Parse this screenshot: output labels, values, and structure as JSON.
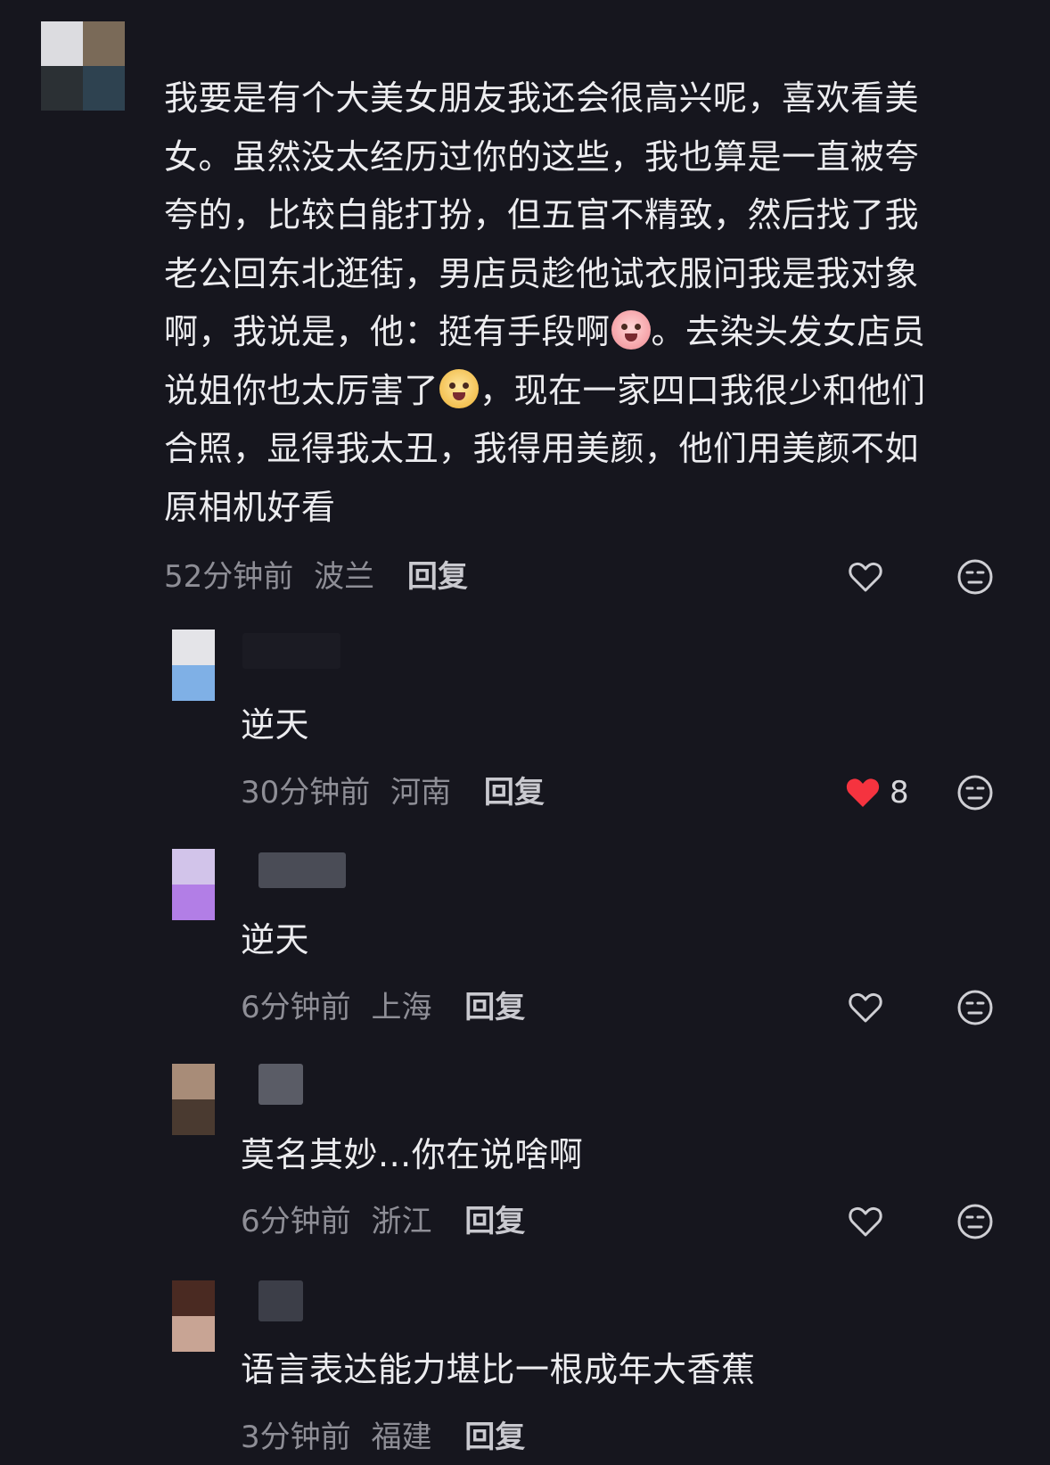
{
  "comments": [
    {
      "text_lines": [
        "我要是有个大美女朋友我还会很高兴呢，喜欢看美",
        "女。虽然没太经历过你的这些，我也算是一直被夸",
        "夸的，比较白能打扮，但五官不精致，然后找了我",
        "老公回东北逛街，男店员趁他试衣服问我是我对象",
        "啊，我说是，他：挺有手段啊",
        "。去染头发女店员",
        "说姐你也太厉害了",
        "，现在一家四口我很少和他们",
        "合照，显得我太丑，我得用美颜，他们用美颜不如",
        "原相机好看"
      ],
      "time": "52分钟前",
      "location": "波兰",
      "reply_label": "回复",
      "liked": false,
      "like_count": "",
      "avatar_colors": [
        "#dcdce0",
        "#7a6a58",
        "#2b3034",
        "#2e4250"
      ]
    },
    {
      "text": "逆天",
      "time": "30分钟前",
      "location": "河南",
      "reply_label": "回复",
      "liked": true,
      "like_count": "8",
      "avatar_colors": [
        "#e4e4e8",
        "#7fb0e6"
      ]
    },
    {
      "text": "逆天",
      "time": "6分钟前",
      "location": "上海",
      "reply_label": "回复",
      "liked": false,
      "like_count": "",
      "avatar_colors": [
        "#d2c4ea",
        "#b27ee6"
      ]
    },
    {
      "text": "莫名其妙...你在说啥啊",
      "time": "6分钟前",
      "location": "浙江",
      "reply_label": "回复",
      "liked": false,
      "like_count": "",
      "avatar_colors": [
        "#a88c78",
        "#4a3a30"
      ]
    },
    {
      "text": "语言表达能力堪比一根成年大香蕉",
      "time": "3分钟前",
      "location": "福建",
      "reply_label": "回复",
      "liked": false,
      "like_count": "",
      "avatar_colors": [
        "#4a2a22",
        "#c8a494"
      ]
    }
  ],
  "icons": {
    "like": "heart-outline-icon",
    "liked": "heart-filled-icon",
    "dislike": "meh-face-icon",
    "emoji_cry": "crying-face-emoji",
    "emoji_dog": "dog-face-emoji"
  },
  "colors": {
    "background": "#16161e",
    "liked_heart": "#f5333f",
    "meta_text": "#8e8e96"
  }
}
